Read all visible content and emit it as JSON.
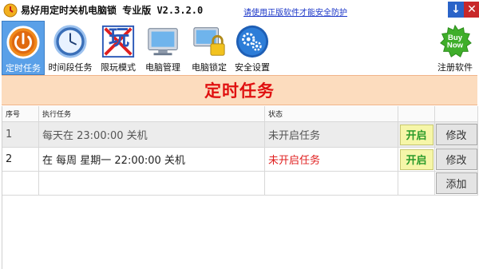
{
  "window": {
    "title": "易好用定时关机电脑锁 专业版 V2.3.2.0",
    "notice_link": "请使用正版软件才能安全防护",
    "minimize_symbol": "↓",
    "close_symbol": "✕"
  },
  "toolbar": {
    "items": [
      {
        "label": "定时任务",
        "icon": "power-icon",
        "active": true
      },
      {
        "label": "时间段任务",
        "icon": "clock-icon"
      },
      {
        "label": "限玩模式",
        "icon": "restrict-play-icon",
        "glyph": "玩"
      },
      {
        "label": "电脑管理",
        "icon": "monitor-icon"
      },
      {
        "label": "电脑锁定",
        "icon": "lock-computer-icon"
      },
      {
        "label": "安全设置",
        "icon": "gears-icon"
      }
    ],
    "register": {
      "label": "注册软件",
      "badge_line1": "Buy",
      "badge_line2": "Now"
    }
  },
  "banner": {
    "title": "定时任务"
  },
  "table": {
    "headers": [
      "序号",
      "执行任务",
      "状态"
    ],
    "rows": [
      {
        "index": "1",
        "task": "每天在 23:00:00 关机",
        "status": "未开启任务",
        "toggle": "开启",
        "edit": "修改"
      },
      {
        "index": "2",
        "task": "在 每周 星期一 22:00:00 关机",
        "status": "未开启任务",
        "toggle": "开启",
        "edit": "修改"
      }
    ],
    "add_label": "添加"
  },
  "colors": {
    "active_tab": "#5aa0e8",
    "banner_bg": "#fcdcbe",
    "banner_text": "#e01010",
    "status_red": "#e02020",
    "toggle_text": "#2a9a2a"
  }
}
